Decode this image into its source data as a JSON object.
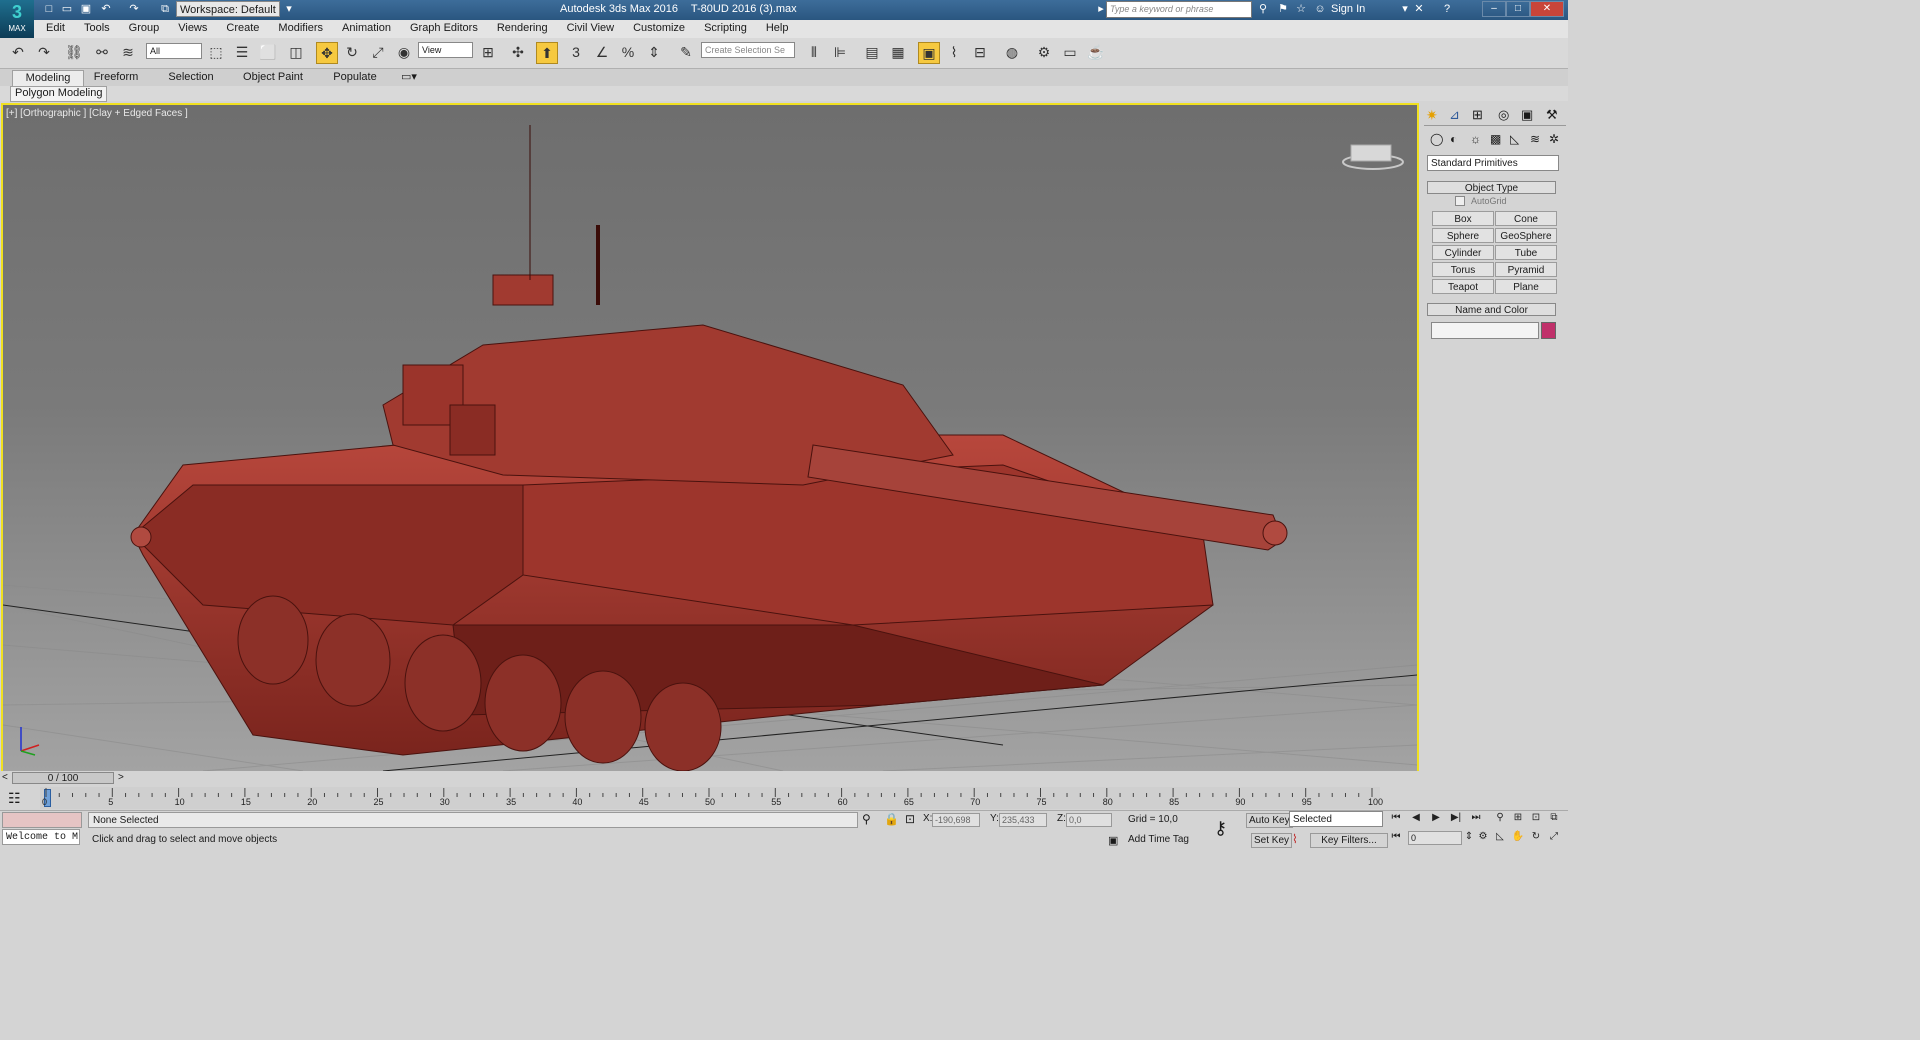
{
  "titlebar": {
    "logo_text": "MAX",
    "workspace": "Workspace: Default",
    "app_name": "Autodesk 3ds Max 2016",
    "file_name": "T-80UD 2016 (3).max",
    "search_placeholder": "Type a keyword or phrase",
    "sign_in": "Sign In"
  },
  "menu": [
    "Edit",
    "Tools",
    "Group",
    "Views",
    "Create",
    "Modifiers",
    "Animation",
    "Graph Editors",
    "Rendering",
    "Civil View",
    "Customize",
    "Scripting",
    "Help"
  ],
  "toolbar": {
    "selection_filter": "All",
    "ref_coord": "View",
    "selection_set_placeholder": "Create Selection Se"
  },
  "ribbon": {
    "tabs": [
      "Modeling",
      "Freeform",
      "Selection",
      "Object Paint",
      "Populate"
    ],
    "panel": "Polygon Modeling"
  },
  "viewport": {
    "label": "[+] [Orthographic ] [Clay + Edged Faces ]",
    "background_color": "#7a7a7a",
    "border_color": "#f0e020",
    "model_color": "#a83a32"
  },
  "command_panel": {
    "category": "Standard Primitives",
    "object_type_title": "Object Type",
    "autogrid": "AutoGrid",
    "buttons": [
      "Box",
      "Cone",
      "Sphere",
      "GeoSphere",
      "Cylinder",
      "Tube",
      "Torus",
      "Pyramid",
      "Teapot",
      "Plane"
    ],
    "name_color_title": "Name and Color",
    "name_value": "",
    "color_swatch": "#c0306a"
  },
  "timeline": {
    "slider": "0 / 100",
    "ticks": [
      "0",
      "5",
      "10",
      "15",
      "20",
      "25",
      "30",
      "35",
      "40",
      "45",
      "50",
      "55",
      "60",
      "65",
      "70",
      "75",
      "80",
      "85",
      "90",
      "95",
      "100"
    ]
  },
  "status": {
    "maxscript": "Welcome to M",
    "selection": "None Selected",
    "prompt": "Click and drag to select and move objects",
    "x_label": "X:",
    "x_value": "-190,698",
    "y_label": "Y:",
    "y_value": "235,433",
    "z_label": "Z:",
    "z_value": "0,0",
    "grid": "Grid = 10,0",
    "add_time_tag": "Add Time Tag",
    "auto_key": "Auto Key",
    "set_key": "Set Key",
    "key_mode": "Selected",
    "key_filters": "Key Filters...",
    "frame": "0"
  }
}
